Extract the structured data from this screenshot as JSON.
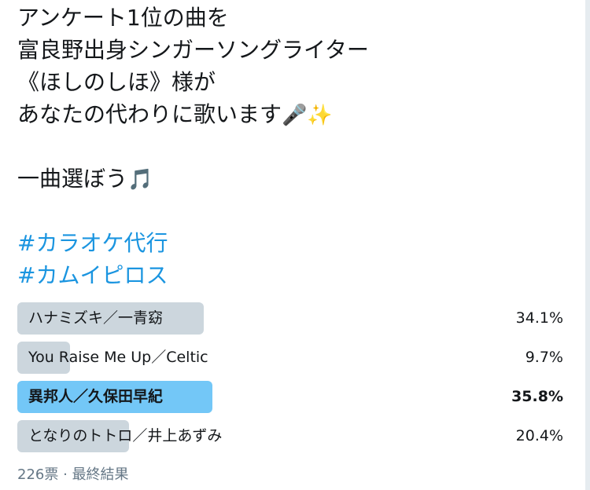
{
  "tweet": {
    "lines": [
      "アンケート1位の曲を",
      "富良野出身シンガーソングライター",
      "《ほしのしほ》様が",
      "あなたの代わりに歌います"
    ],
    "line4_emoji": [
      "🎤",
      "✨"
    ],
    "line_choose": "一曲選ぼう",
    "choose_emoji": "🎵",
    "hashtags": [
      "#カラオケ代行",
      "#カムイピロス"
    ]
  },
  "poll": {
    "choices": [
      {
        "label": "ハナミズキ／一青窈",
        "percent": "34.1%",
        "value": 34.1,
        "winner": false
      },
      {
        "label": "You Raise Me Up／Celtic",
        "percent": "9.7%",
        "value": 9.7,
        "winner": false
      },
      {
        "label": "異邦人／久保田早紀",
        "percent": "35.8%",
        "value": 35.8,
        "winner": true
      },
      {
        "label": "となりのトトロ／井上あずみ",
        "percent": "20.4%",
        "value": 20.4,
        "winner": false
      }
    ],
    "votes": "226票",
    "separator": "·",
    "status": "最終結果"
  },
  "colors": {
    "text": "#14171a",
    "hashtag": "#1b95e0",
    "bar_default": "#ccd6dd",
    "bar_winner": "#73c7f7",
    "meta": "#657786"
  }
}
